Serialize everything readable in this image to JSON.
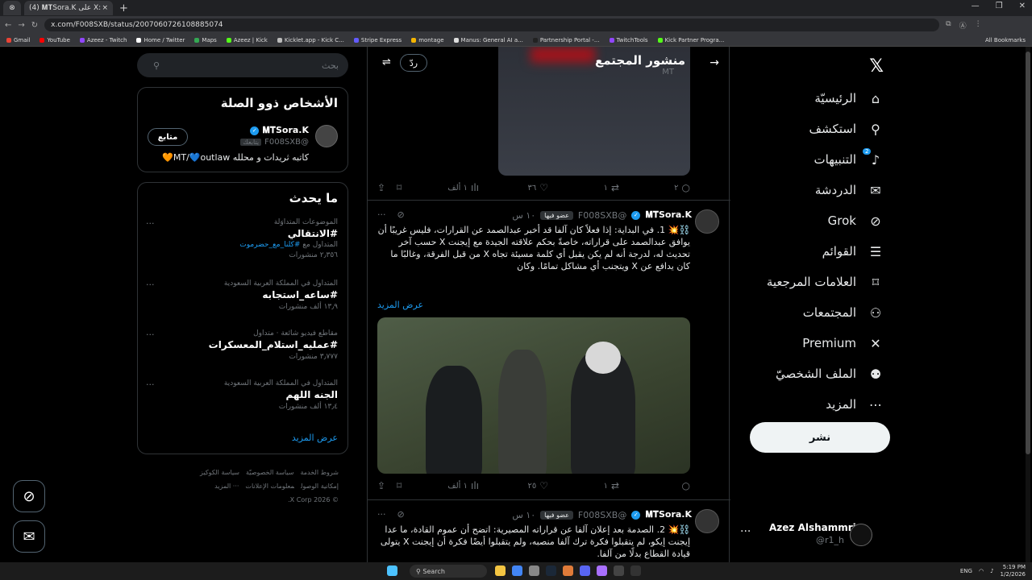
{
  "browser": {
    "tabs": [
      {
        "label": "⊗"
      },
      {
        "label": "(4) 𝐌𝐓Sora.K على X: \"🏁⚠️ عسل وقا"
      }
    ],
    "url": "x.com/F008SXB/status/2007060726108885074",
    "bookmarks": [
      "Gmail",
      "YouTube",
      "Azeez - Twitch",
      "Home / Twitter",
      "Maps",
      "Azeez | Kick",
      "Kicklet.app - Kick C...",
      "Stripe Express",
      "montage",
      "Manus: General AI a...",
      "Partnership Portal -...",
      "TwitchTools",
      "Kick Partner Progra..."
    ],
    "all_bookmarks": "All Bookmarks"
  },
  "nav": {
    "items": [
      {
        "label": "الرئيسيّة",
        "icon": "home-icon",
        "glyph": "⌂"
      },
      {
        "label": "استكشف",
        "icon": "search-icon",
        "glyph": "⚲"
      },
      {
        "label": "التنبيهات",
        "icon": "bell-icon",
        "glyph": "🔔︎",
        "badge": "2"
      },
      {
        "label": "الدردشة",
        "icon": "mail-icon",
        "glyph": "✉"
      },
      {
        "label": "Grok",
        "icon": "grok-icon",
        "glyph": "⊘"
      },
      {
        "label": "القوائم",
        "icon": "list-icon",
        "glyph": "☰"
      },
      {
        "label": "العلامات المرجعية",
        "icon": "bookmark-icon",
        "glyph": "🔖︎"
      },
      {
        "label": "المجتمعات",
        "icon": "communities-icon",
        "glyph": "⚇"
      },
      {
        "label": "Premium",
        "icon": "x-premium-icon",
        "glyph": "✕"
      },
      {
        "label": "الملف الشخصيّ",
        "icon": "profile-icon",
        "glyph": "⚉"
      },
      {
        "label": "المزيد",
        "icon": "more-icon",
        "glyph": "⋯"
      }
    ],
    "post_button": "نشر",
    "account": {
      "name": "Azez Alshammri",
      "handle": "@r1_h"
    }
  },
  "main": {
    "header_title": "منشور المجتمع",
    "header_sub": "MT",
    "reply_button": "ردّ",
    "top_actions": {
      "replies": "٢",
      "reposts": "١",
      "likes": "٣٦",
      "views": "١ ألف"
    },
    "tweets": [
      {
        "name": "𝐌𝐓Sora.K",
        "handle": "@F008SXB",
        "member_tag": "عضو فيها",
        "time": "١٠ س",
        "body": "⛓️💥 1. في البداية: إذا فعلاً كان آلفا قد أخبر عبدالصمد عن القرارات، فليس غريبًا أن يوافق عبدالصمد على قراراته، خاصةً بحكم علاقته الجيدة مع إيجنت X حسب آخر تحديث له، لدرجة أنه لم يكن يقبل أي كلمة مسيئة تجاه X من قبل الفرقة، وغالبًا ما كان يدافع عن X ويتجنب أي مشاكل تمامًا. وكان",
        "show_more": "عرض المزيد",
        "actions": {
          "replies": "",
          "reposts": "١",
          "likes": "٢٥",
          "views": "١ ألف"
        }
      },
      {
        "name": "𝐌𝐓Sora.K",
        "handle": "@F008SXB",
        "member_tag": "عضو فيها",
        "time": "١٠ س",
        "body": "⛓️💥 2. الصدمة بعد إعلان آلفا عن قراراته المصيرية: اتضح أن عموم القادة، ما عدا إيجنت إيكو، لم يتقبلوا فكرة ترك آلفا منصبه، ولم يتقبلوا أيضًا فكرة أن إيجنت X يتولى قيادة القطاع بدلًا من آلفا."
      }
    ]
  },
  "sidebar": {
    "search_placeholder": "بحث",
    "related": {
      "title": "الأشخاص ذوو الصلة",
      "name": "𝐌𝐓Sora.K",
      "handle": "@F008SXB",
      "follows_you": "يتابعك",
      "follow_button": "متابع",
      "bio": "كاتبه ثريدات و محلله MT/💙outlaw🧡"
    },
    "trends": {
      "title": "ما يحدث",
      "items": [
        {
          "category": "الموضوعات المتداوَلة",
          "name": "#الانتقالي",
          "extra_tag": "#كلنا_مع_حضرموت",
          "extra_suffix": "المتداول مع",
          "count": "٢٫٣٥٦ منشورات"
        },
        {
          "category": "المتداول في المملكة العربية السعودية",
          "name": "#ساعه_استجابه",
          "count": "١٣٫٩ ألف منشورات"
        },
        {
          "category": "مقاطع فيديو شائعة · متداول",
          "name": "#عمليه_استلام_المعسكرات",
          "count": "٣٫٧٧٧ منشورات"
        },
        {
          "category": "المتداول في المملكة العربية السعودية",
          "name": "الجنه اللهم",
          "count": "١٣٫٤ ألف منشورات"
        }
      ],
      "show_more": "عرض المزيد"
    },
    "footer": {
      "line1": [
        "شروط الخدمة",
        "سياسة الخصوصيّة",
        "سياسة الكوكيز"
      ],
      "line2": [
        "إمكانية الوصول",
        "معلومات الإعلانات",
        "··· المزيد"
      ],
      "copyright": "© 2026 X Corp."
    }
  },
  "taskbar": {
    "search": "Search",
    "lang": "ENG",
    "time": "5:19 PM",
    "date": "1/2/2026"
  },
  "colors": {
    "accent": "#1d9bf0",
    "background": "#000000",
    "border": "#2f3336",
    "muted": "#71767b"
  }
}
